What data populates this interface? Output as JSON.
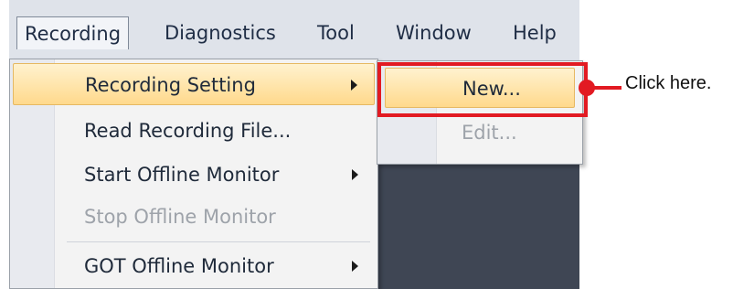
{
  "menubar": {
    "items": [
      {
        "label": "Recording",
        "active": true
      },
      {
        "label": "Diagnostics"
      },
      {
        "label": "Tool"
      },
      {
        "label": "Window"
      },
      {
        "label": "Help"
      }
    ]
  },
  "recording_menu": {
    "items": [
      {
        "label": "Recording Setting",
        "submenu": true,
        "highlighted": true
      },
      {
        "label": "Read Recording File..."
      },
      {
        "label": "Start Offline Monitor",
        "submenu": true
      },
      {
        "label": "Stop Offline Monitor",
        "disabled": true
      },
      {
        "label": "GOT Offline Monitor",
        "submenu": true
      }
    ]
  },
  "recording_setting_submenu": {
    "items": [
      {
        "label": "New...",
        "highlighted": true
      },
      {
        "label": "Edit...",
        "disabled": true
      }
    ]
  },
  "callout": {
    "text": "Click here.",
    "color": "#e21a22"
  }
}
